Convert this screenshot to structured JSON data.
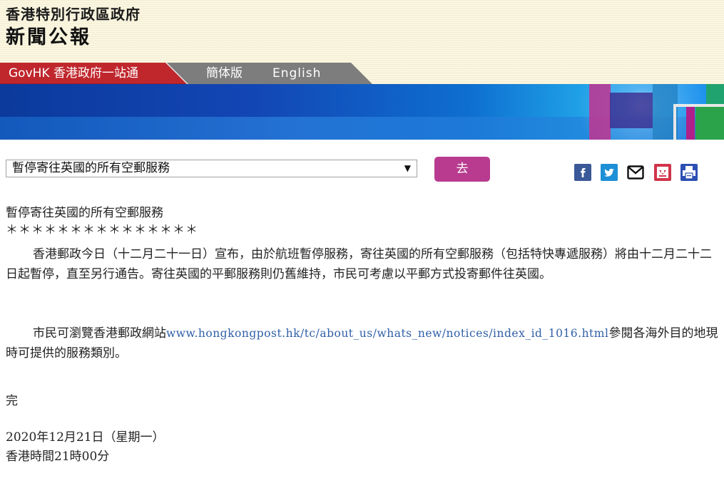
{
  "header": {
    "gov_name": "香港特別行政區政府",
    "title": "新聞公報"
  },
  "nav": {
    "govhk": "GovHK 香港政府一站通",
    "simplified": "簡体版",
    "english": "English"
  },
  "toolbar": {
    "select_value": "暫停寄往英國的所有空郵服務",
    "go_label": "去",
    "icons": [
      "facebook-icon",
      "twitter-icon",
      "email-icon",
      "bookmark-icon",
      "print-icon"
    ]
  },
  "article": {
    "heading": "暫停寄往英國的所有空郵服務",
    "stars": "＊＊＊＊＊＊＊＊＊＊＊＊＊＊＊",
    "para1": "香港郵政今日（十二月二十一日）宣布，由於航班暫停服務，寄往英國的所有空郵服務（包括特快專遞服務）將由十二月二十二日起暫停，直至另行通告。寄往英國的平郵服務則仍舊維持，市民可考慮以平郵方式投寄郵件往英國。",
    "para2_before": "市民可瀏覽香港郵政網站",
    "para2_link": "www.hongkongpost.hk/tc/about_us/whats_new/notices/index_id_1016.html",
    "para2_after": "參閱各海外目的地現時可提供的服務類別。",
    "end": "完",
    "date": "2020年12月21日（星期一）",
    "time": "香港時間21時00分"
  },
  "colors": {
    "govhk_red": "#c0272d",
    "nav_grey": "#7d7d7d",
    "go_button": "#b83b8f",
    "link_blue": "#2f5fa7"
  }
}
